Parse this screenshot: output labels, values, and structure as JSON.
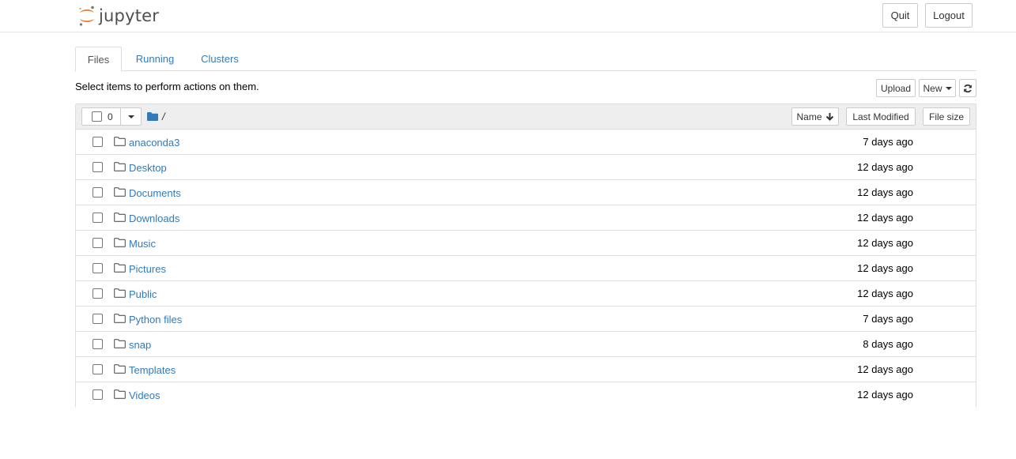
{
  "header": {
    "logo_text": "jupyter",
    "quit_label": "Quit",
    "logout_label": "Logout"
  },
  "tabs": [
    {
      "label": "Files",
      "active": true
    },
    {
      "label": "Running",
      "active": false
    },
    {
      "label": "Clusters",
      "active": false
    }
  ],
  "toolbar": {
    "hint": "Select items to perform actions on them.",
    "upload_label": "Upload",
    "new_label": "New",
    "refresh_icon": "refresh-icon"
  },
  "list_header": {
    "selected_count": "0",
    "breadcrumb": "/",
    "sort_name_label": "Name",
    "sort_modified_label": "Last Modified",
    "sort_size_label": "File size"
  },
  "files": [
    {
      "name": "anaconda3",
      "modified": "7 days ago"
    },
    {
      "name": "Desktop",
      "modified": "12 days ago"
    },
    {
      "name": "Documents",
      "modified": "12 days ago"
    },
    {
      "name": "Downloads",
      "modified": "12 days ago"
    },
    {
      "name": "Music",
      "modified": "12 days ago"
    },
    {
      "name": "Pictures",
      "modified": "12 days ago"
    },
    {
      "name": "Public",
      "modified": "12 days ago"
    },
    {
      "name": "Python files",
      "modified": "7 days ago"
    },
    {
      "name": "snap",
      "modified": "8 days ago"
    },
    {
      "name": "Templates",
      "modified": "12 days ago"
    },
    {
      "name": "Videos",
      "modified": "12 days ago"
    }
  ],
  "colors": {
    "link": "#337ab7",
    "logo_orange": "#f37726",
    "header_border": "#e7e7e7",
    "list_header_bg": "#eeeeee"
  }
}
